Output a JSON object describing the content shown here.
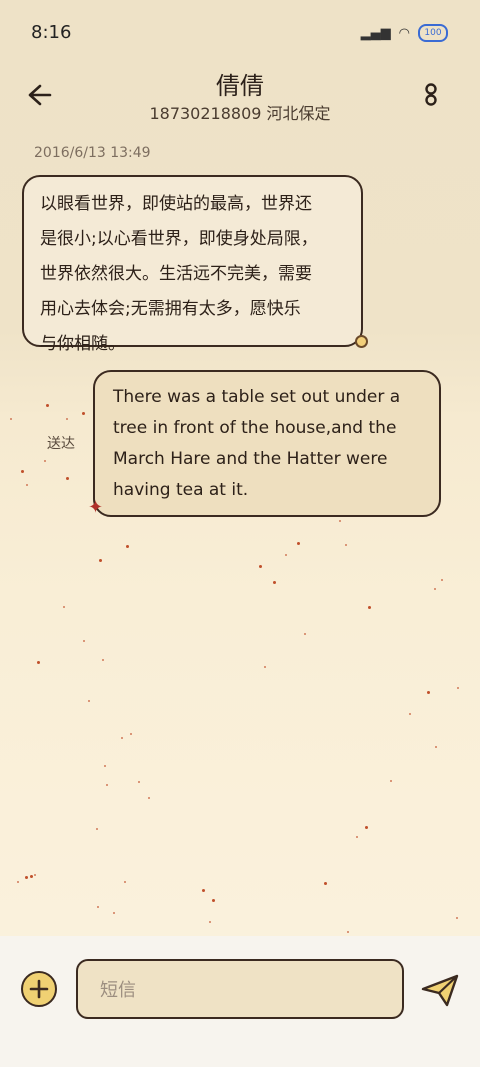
{
  "status_bar": {
    "time": "8:16",
    "battery": "100"
  },
  "header": {
    "contact_name": "倩倩",
    "phone_location": "18730218809 河北保定"
  },
  "messages": [
    {
      "direction": "incoming",
      "timestamp": "2016/6/13 13:49",
      "lines": [
        "以眼看世界，即使站的最高，世界还",
        "是很小;以心看世界，即使身处局限，",
        "世界依然很大。生活远不完美，需要",
        "用心去体会;无需拥有太多，愿快乐",
        "与你相随。"
      ]
    },
    {
      "direction": "outgoing",
      "status": "送达",
      "lines": [
        "There was a table set out under a",
        "tree in front of the house,and the",
        "March Hare and the Hatter were",
        "having tea at it."
      ]
    }
  ],
  "composer": {
    "placeholder": "短信"
  },
  "colors": {
    "accent_yellow": "#f0d173",
    "outline": "#3b2a20",
    "star_red": "#b0312a"
  }
}
